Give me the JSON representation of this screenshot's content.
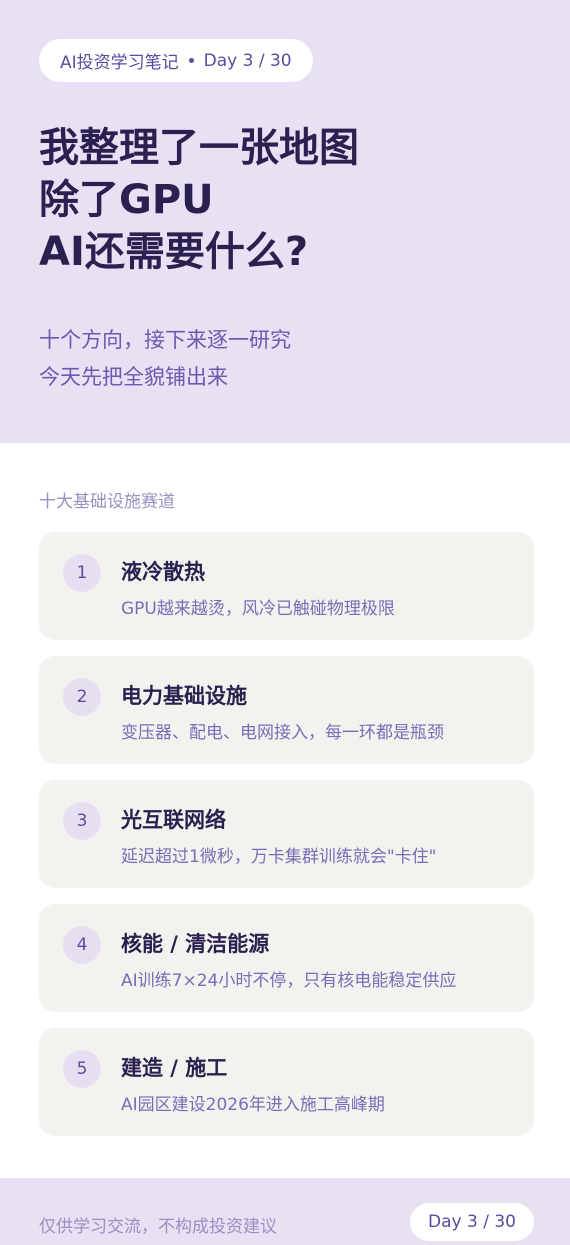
{
  "header": {
    "badge_series": "AI投资学习笔记",
    "badge_day": "Day 3 / 30",
    "title_lines": [
      "我整理了一张地图",
      "除了GPU",
      "AI还需要什么?"
    ],
    "subtitle_lines": [
      "十个方向，接下来逐一研究",
      "今天先把全貌铺出来"
    ]
  },
  "section": {
    "label": "十大基础设施赛道",
    "items": [
      {
        "num": "1",
        "title": "液冷散热",
        "desc": "GPU越来越烫，风冷已触碰物理极限"
      },
      {
        "num": "2",
        "title": "电力基础设施",
        "desc": "变压器、配电、电网接入，每一环都是瓶颈"
      },
      {
        "num": "3",
        "title": "光互联网络",
        "desc": "延迟超过1微秒，万卡集群训练就会\"卡住\""
      },
      {
        "num": "4",
        "title": "核能 / 清洁能源",
        "desc": "AI训练7×24小时不停，只有核电能稳定供应"
      },
      {
        "num": "5",
        "title": "建造 / 施工",
        "desc": "AI园区建设2026年进入施工高峰期"
      }
    ]
  },
  "footer": {
    "disclaimer": "仅供学习交流，不构成投资建议",
    "day": "Day 3 / 30"
  }
}
